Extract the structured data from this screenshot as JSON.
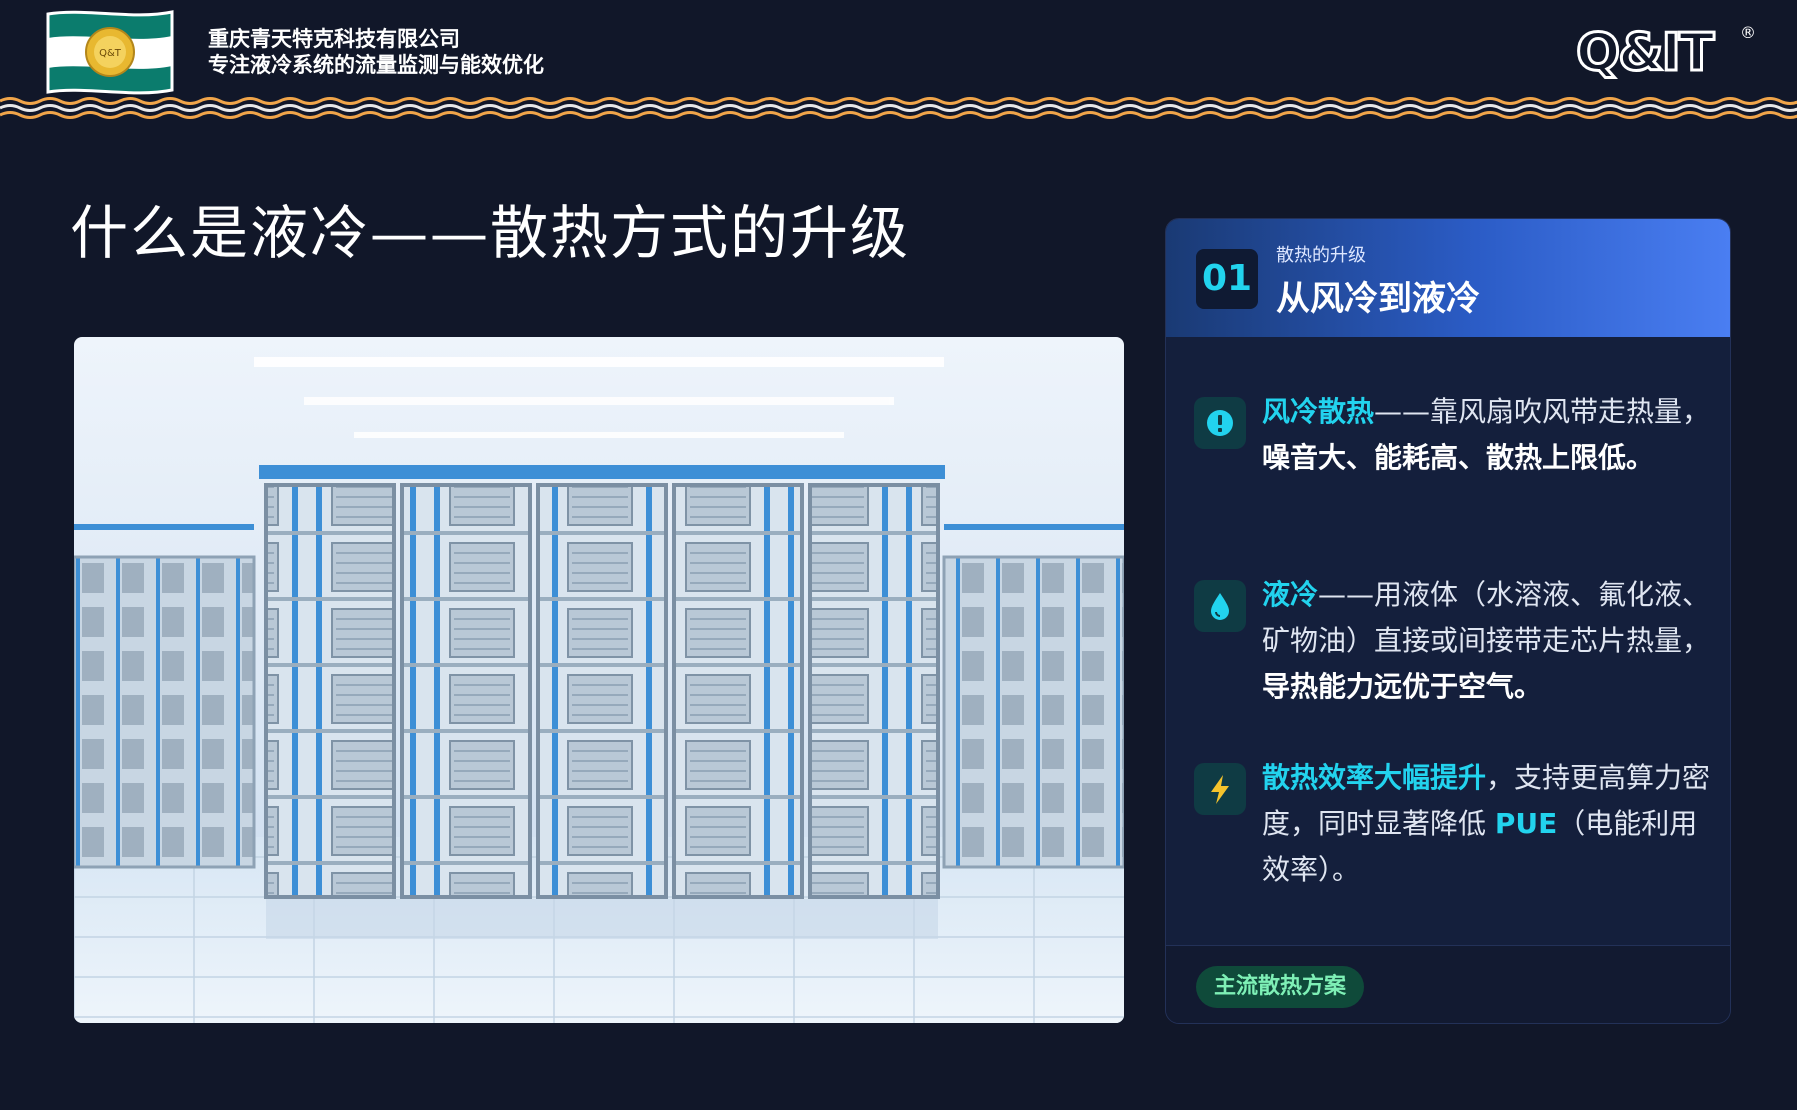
{
  "header": {
    "company_name": "重庆青天特克科技有限公司",
    "company_tagline": "专注液冷系统的流量监测与能效优化",
    "logo_text": "Q&T",
    "brand_mark": "Q&IT",
    "registered_mark": "®"
  },
  "page": {
    "title": "什么是液冷——散热方式的升级"
  },
  "card": {
    "step_number": "01",
    "subtitle": "散热的升级",
    "title": "从风冷到液冷",
    "items": [
      {
        "icon": "alert-icon",
        "highlight": "风冷散热",
        "text": "——靠风扇吹风带走热量，",
        "bold": "噪音大、能耗高、散热上限低。"
      },
      {
        "icon": "water-drop-icon",
        "highlight": "液冷",
        "text": "——用液体（水溶液、氟化液、矿物油）直接或间接带走芯片热量，",
        "bold": "导热能力远优于空气。"
      },
      {
        "icon": "lightning-icon",
        "highlight": "散热效率大幅提升",
        "text": "，支持更高算力密度，同时显著降低 ",
        "highlight2": "PUE",
        "text2": "（电能利用效率）。"
      }
    ],
    "tag": "主流散热方案"
  },
  "colors": {
    "background": "#111729",
    "accent_cyan": "#22d3ee",
    "card_header_blue": "#4a7ef2",
    "tag_green": "#7ef0b6"
  }
}
